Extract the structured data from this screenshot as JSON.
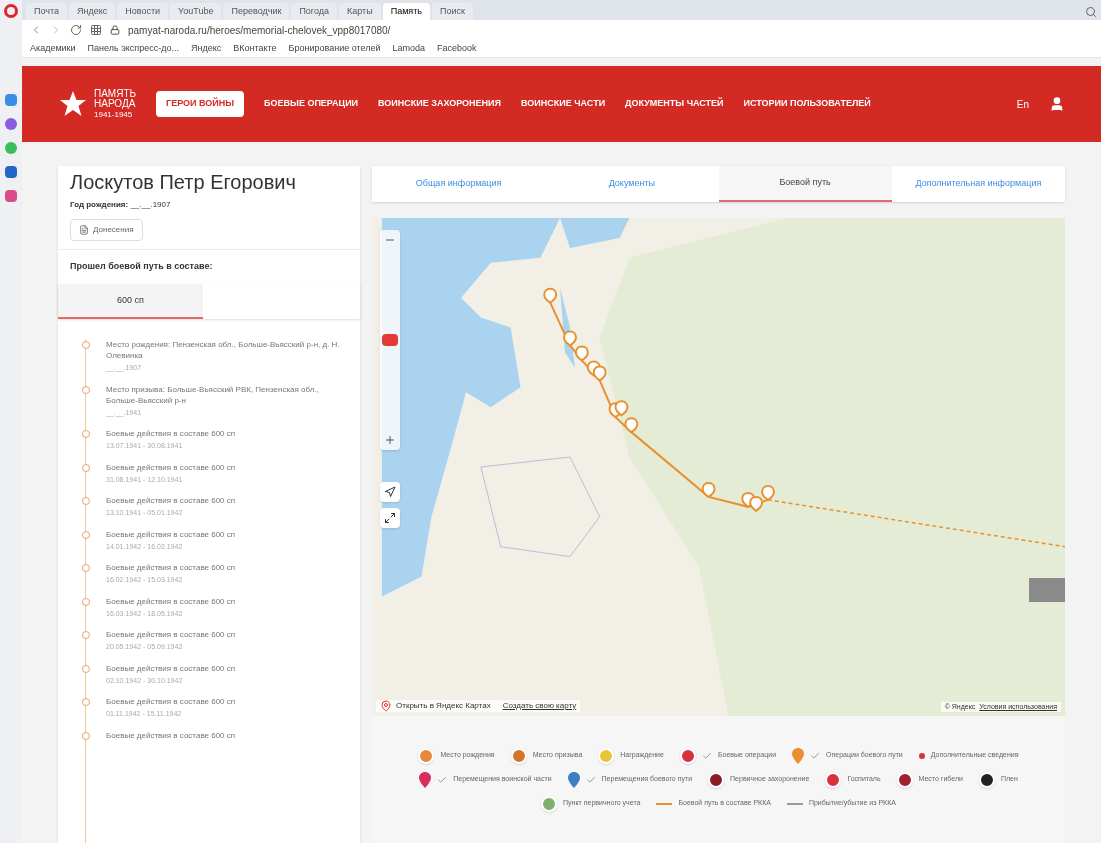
{
  "browser": {
    "tabs": [
      {
        "label": "Почта",
        "selected": false
      },
      {
        "label": "Яндекс",
        "selected": false
      },
      {
        "label": "Новости",
        "selected": false
      },
      {
        "label": "YouTube",
        "selected": false
      },
      {
        "label": "Переводчик",
        "selected": false
      },
      {
        "label": "Погода",
        "selected": false
      },
      {
        "label": "Карты",
        "selected": false
      },
      {
        "label": "Память",
        "selected": true
      },
      {
        "label": "Поиск",
        "selected": false
      }
    ],
    "url": "pamyat-naroda.ru/heroes/memorial-chelovek_vpp8017080/",
    "bookmarks": [
      "Академики",
      "Панель экспресс-до...",
      "Яндекс",
      "ВКонтакте",
      "Бронирование отелей",
      "Lamoda",
      "Facebook"
    ]
  },
  "header": {
    "logo": {
      "line1": "ПАМЯТЬ",
      "line2": "НАРОДА",
      "line3": "1941-1945"
    },
    "nav": [
      {
        "label": "ГЕРОИ ВОЙНЫ",
        "selected": true
      },
      {
        "label": "БОЕВЫЕ ОПЕРАЦИИ",
        "selected": false
      },
      {
        "label": "ВОИНСКИЕ ЗАХОРОНЕНИЯ",
        "selected": false
      },
      {
        "label": "ВОИНСКИЕ ЧАСТИ",
        "selected": false
      },
      {
        "label": "ДОКУМЕНТЫ ЧАСТЕЙ",
        "selected": false
      },
      {
        "label": "ИСТОРИИ ПОЛЬЗОВАТЕЛЕЙ",
        "selected": false
      }
    ],
    "language": "En"
  },
  "person": {
    "name": "Лоскутов Петр Егорович",
    "birth_label": "Год рождения:",
    "birth_value": "__.__.1907",
    "documents_button": "Донесения",
    "path_label": "Прошел боевой путь в составе:",
    "units": [
      {
        "label": "600 сп",
        "selected": true
      }
    ],
    "timeline": [
      {
        "text": "Место рождения: Пензенская обл., Больше-Вьясский р-н, д. Н. Олевинка",
        "date": "__.__.1907"
      },
      {
        "text": "Место призыва: Больше-Вьясский РВК, Пензенская обл., Больше-Вьясский р-н",
        "date": "__.__.1941"
      },
      {
        "text": "Боевые действия в составе 600 сп",
        "date": "13.07.1941 - 30.08.1941"
      },
      {
        "text": "Боевые действия в составе 600 сп",
        "date": "31.08.1941 - 12.10.1941"
      },
      {
        "text": "Боевые действия в составе 600 сп",
        "date": "13.10.1941 - 05.01.1942"
      },
      {
        "text": "Боевые действия в составе 600 сп",
        "date": "14.01.1942 - 16.02.1942"
      },
      {
        "text": "Боевые действия в составе 600 сп",
        "date": "16.02.1942 - 15.03.1942"
      },
      {
        "text": "Боевые действия в составе 600 сп",
        "date": "16.03.1942 - 18.05.1942"
      },
      {
        "text": "Боевые действия в составе 600 сп",
        "date": "20.05.1942 - 05.09.1942"
      },
      {
        "text": "Боевые действия в составе 600 сп",
        "date": "02.10.1942 - 30.10.1942"
      },
      {
        "text": "Боевые действия в составе 600 сп",
        "date": "01.11.1942 - 15.11.1942"
      },
      {
        "text": "Боевые действия в составе 600 сп"
      }
    ]
  },
  "tabs": [
    {
      "label": "Общая информация",
      "selected": false
    },
    {
      "label": "Документы",
      "selected": false
    },
    {
      "label": "Боевой путь",
      "selected": true
    },
    {
      "label": "Дополнительная информация",
      "selected": false
    }
  ],
  "map": {
    "open_link": "Открыть в Яндекс Картах",
    "create_link": "Создать свою карту",
    "copyright": "© Яндекс",
    "terms_link": "Условия использования"
  },
  "legend": [
    {
      "label": "Место рождения",
      "color": "#e8873a",
      "kind": "circle",
      "checked": false
    },
    {
      "label": "Место призыва",
      "color": "#d2762e",
      "kind": "circle",
      "checked": false
    },
    {
      "label": "Награждение",
      "color": "#e8c53a",
      "kind": "circle",
      "checked": false
    },
    {
      "label": "Боевые операции",
      "color": "#d9313d",
      "kind": "circle",
      "checked": true
    },
    {
      "label": "Операции боевого пути",
      "color": "#e8912e",
      "kind": "pin",
      "checked": true
    },
    {
      "label": "Дополнительные сведения",
      "color": "#d9313d",
      "kind": "dot",
      "checked": false
    },
    {
      "label": "Перемещения воинской части",
      "color": "#d62d5a",
      "kind": "pin",
      "checked": true
    },
    {
      "label": "Перемещения боевого пути",
      "color": "#3a7fc4",
      "kind": "pin",
      "checked": true
    },
    {
      "label": "Первичное захоронение",
      "color": "#8a1c24",
      "kind": "circle",
      "checked": false
    },
    {
      "label": "Госпиталь",
      "color": "#d9313d",
      "kind": "circle",
      "checked": false
    },
    {
      "label": "Место гибели",
      "color": "#a3202e",
      "kind": "circle",
      "checked": false
    },
    {
      "label": "Плен",
      "color": "#222222",
      "kind": "circle",
      "checked": false
    },
    {
      "label": "Пункт первичного учета",
      "color": "#7fae70",
      "kind": "circle",
      "checked": false
    },
    {
      "label": "Боевой путь в составе РККА",
      "color": "#e8912e",
      "kind": "line",
      "checked": false
    },
    {
      "label": "Прибытие/убытие из РККА",
      "color": "#9a9a9a",
      "kind": "line",
      "checked": false
    }
  ]
}
